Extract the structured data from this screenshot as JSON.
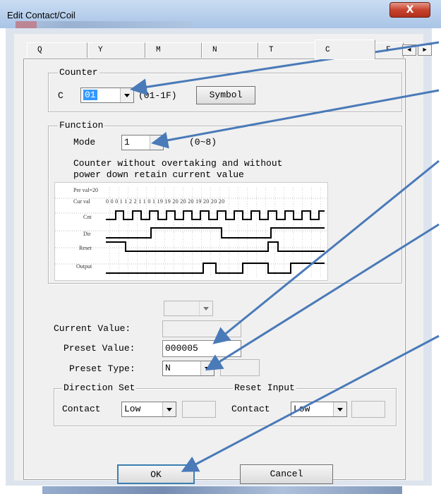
{
  "window": {
    "title": "Edit Contact/Coil",
    "close_label": "X"
  },
  "tabs": [
    {
      "label": "Q"
    },
    {
      "label": "Y"
    },
    {
      "label": "M"
    },
    {
      "label": "N"
    },
    {
      "label": "T"
    },
    {
      "label": "C",
      "selected": true
    },
    {
      "label": "F"
    }
  ],
  "tab_arrows": {
    "left": "◄",
    "right": "►"
  },
  "counter": {
    "legend": "Counter",
    "prefix": "C",
    "selected": "01",
    "range": "(01-1F)",
    "symbol_button": "Symbol"
  },
  "function": {
    "legend": "Function",
    "mode_label": "Mode",
    "mode_value": "1",
    "mode_range": "(0~8)",
    "description_line1": "Counter without overtaking and without",
    "description_line2": "power down retain current value"
  },
  "timing_diagram": {
    "preset_label": "Pre val=20",
    "cur_label": "Cur val",
    "cur_values": "0 0 0 1 1 2 2 1 1 0 1 19 19 20 20 20 19 20 20 20",
    "signals": [
      {
        "name": "Cnt"
      },
      {
        "name": "Dir"
      },
      {
        "name": "Reset"
      },
      {
        "name": "Output"
      }
    ]
  },
  "values": {
    "current_value_label": "Current Value:",
    "current_value": "",
    "preset_value_label": "Preset Value:",
    "preset_value": "000005",
    "preset_type_label": "Preset Type:",
    "preset_type": "N",
    "preset_extra": ""
  },
  "direction_set": {
    "legend": "Direction Set",
    "contact_label": "Contact",
    "value": "Low"
  },
  "reset_input": {
    "legend": "Reset Input",
    "contact_label": "Contact",
    "value": "Low"
  },
  "buttons": {
    "ok": "OK",
    "cancel": "Cancel"
  },
  "colors": {
    "arrow": "#4a7ab8",
    "selection": "#3399ff",
    "close": "#c8442e"
  }
}
